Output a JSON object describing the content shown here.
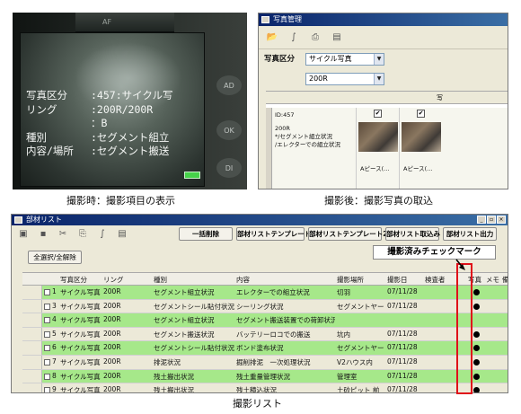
{
  "captions": {
    "camera": "撮影時：撮影項目の表示",
    "manager": "撮影後：撮影写真の取込",
    "list": "撮影リスト"
  },
  "camera": {
    "brand": "AF",
    "side_buttons": [
      "AD",
      "OK",
      "DI"
    ],
    "overlay": [
      {
        "key": "写真区分",
        "value": ":457:サイクル写"
      },
      {
        "key": "リング",
        "value": ":200R/200R"
      },
      {
        "key": "",
        "value": "：B"
      },
      {
        "key": "種別",
        "value": ":セグメント組立"
      },
      {
        "key": "内容/場所",
        "value": ":セグメント搬送"
      }
    ],
    "battery_icon": "battery-icon"
  },
  "photo_manager": {
    "title": "写真管理",
    "toolbar_icons": [
      "folder-open-icon",
      "curve-icon",
      "print-icon",
      "new-doc-icon"
    ],
    "filter_label": "写真区分",
    "filter_value": "サイクル写真",
    "ring_value": "200R",
    "column_header": "写",
    "record": {
      "id": "ID:457",
      "lines": [
        "200R",
        "*/セグメント組立状況",
        "/エレクターでの組立状況"
      ]
    },
    "thumbs": [
      {
        "checked": "✔",
        "label": "Aピース(…"
      },
      {
        "checked": "✔",
        "label": "Aピース(…"
      }
    ]
  },
  "parts_list": {
    "title": "部材リスト",
    "window_buttons": [
      "_",
      "▫",
      "×"
    ],
    "toolbar_buttons": [
      "一括削除",
      "部材リストテンプレート",
      "部材リストテンプレート2",
      "部材リスト取込み",
      "部材リスト出力"
    ],
    "select_all": "全選択/全解除",
    "columns": [
      "写真区分",
      "リング",
      "種別",
      "内容",
      "撮影場所",
      "撮影日",
      "検査者",
      "写真",
      "メモ",
      "備"
    ],
    "rows": [
      {
        "no": "1",
        "kubun": "サイクル写真",
        "ring": "200R",
        "shubetsu": "セグメント組立状況",
        "naiyo": "エレクターでの組立状況",
        "basho": "切羽",
        "date": "07/11/28",
        "photo": true,
        "green": true
      },
      {
        "no": "3",
        "kubun": "サイクル写真",
        "ring": "200R",
        "shubetsu": "セグメントシール貼付状況",
        "naiyo": "シーリング状況",
        "basho": "セグメントヤード",
        "date": "07/11/28",
        "photo": true,
        "green": false
      },
      {
        "no": "4",
        "kubun": "サイクル写真",
        "ring": "200R",
        "shubetsu": "セグメント組立状況",
        "naiyo": "セグメント搬送装置での荷卸状況",
        "basho": "",
        "date": "",
        "photo": false,
        "green": true
      },
      {
        "no": "5",
        "kubun": "サイクル写真",
        "ring": "200R",
        "shubetsu": "セグメント搬送状況",
        "naiyo": "バッテリーロコでの搬送",
        "basho": "坑内",
        "date": "07/11/28",
        "photo": true,
        "green": false
      },
      {
        "no": "6",
        "kubun": "サイクル写真",
        "ring": "200R",
        "shubetsu": "セグメントシール貼付状況",
        "naiyo": "ボンド塗布状況",
        "basho": "セグメントヤード",
        "date": "07/11/28",
        "photo": true,
        "green": true
      },
      {
        "no": "7",
        "kubun": "サイクル写真",
        "ring": "200R",
        "shubetsu": "排泥状況",
        "naiyo": "掘削排泥　一次処理状況",
        "basho": "V2ハウス内",
        "date": "07/11/28",
        "photo": true,
        "green": false
      },
      {
        "no": "8",
        "kubun": "サイクル写真",
        "ring": "200R",
        "shubetsu": "残土搬出状況",
        "naiyo": "残土重量管理状況",
        "basho": "管理室",
        "date": "07/11/28",
        "photo": true,
        "green": true
      },
      {
        "no": "9",
        "kubun": "サイクル写真",
        "ring": "200R",
        "shubetsu": "残土搬出状況",
        "naiyo": "残土積込状況",
        "basho": "土砂ピット 前",
        "date": "07/11/28",
        "photo": true,
        "green": false
      }
    ],
    "callout": "撮影済みチェックマーク",
    "highlight_color": "#e0101a",
    "row_green": "#a6e88a"
  }
}
